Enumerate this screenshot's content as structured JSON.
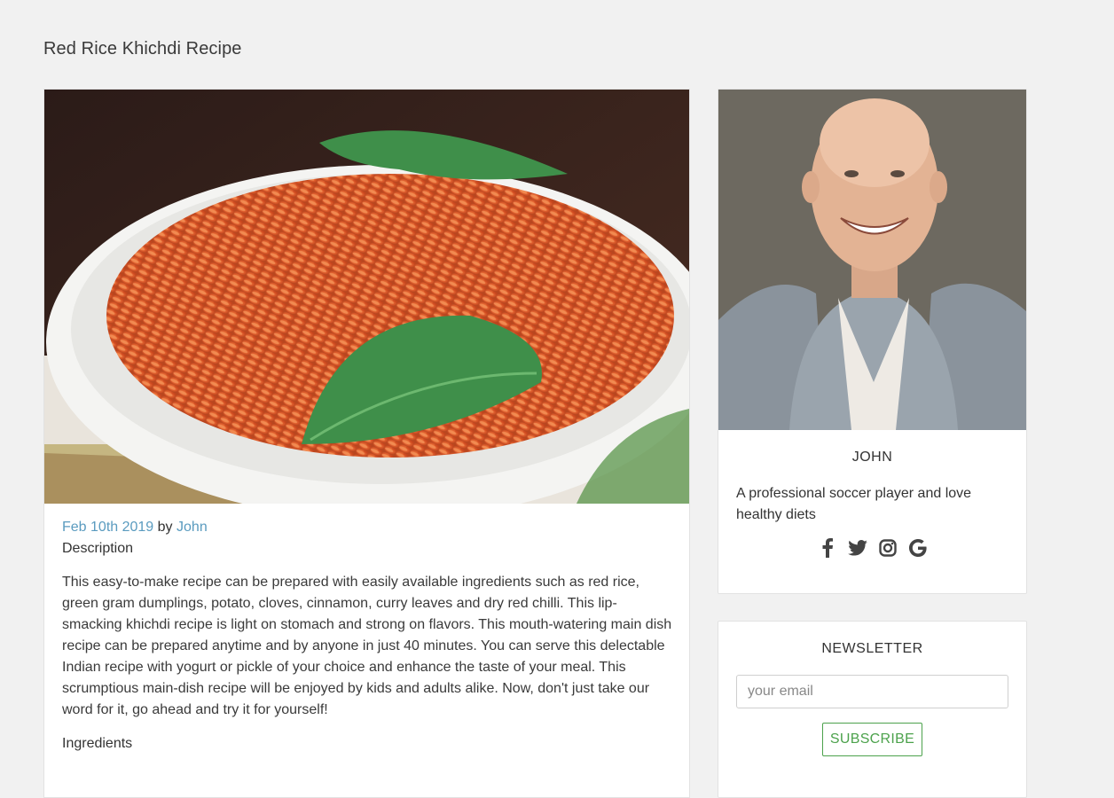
{
  "page": {
    "title": "Red Rice Khichdi Recipe"
  },
  "recipe": {
    "date": "Feb 10th 2019",
    "by": "by",
    "author": "John",
    "description_label": "Description",
    "text": "This easy-to-make recipe can be prepared with easily available ingredients such as red rice, green gram dumplings, potato, cloves, cinnamon, curry leaves and dry red chilli. This lip-smacking khichdi recipe is light on stomach and strong on flavors. This mouth-watering main dish recipe can be prepared anytime and by anyone in just 40 minutes. You can serve this delectable Indian recipe with yogurt or pickle of your choice and enhance the taste of your meal. This scrumptious main-dish recipe will be enjoyed by kids and adults alike. Now, don't just take our word for it, go ahead and try it for yourself!",
    "ingredients_label": "Ingredients",
    "image_icon": "red-rice-khichdi-photo"
  },
  "author_card": {
    "name": "JOHN",
    "bio": "A professional soccer player and love healthy diets",
    "photo_icon": "author-portrait-photo",
    "social": [
      "facebook-icon",
      "twitter-icon",
      "instagram-icon",
      "google-icon"
    ]
  },
  "newsletter": {
    "title": "NEWSLETTER",
    "email_placeholder": "your email",
    "email_value": "",
    "subscribe_label": "SUBSCRIBE"
  },
  "colors": {
    "link": "#5a9bbf",
    "subscribe": "#4ca24c",
    "background": "#f1f1f1"
  }
}
